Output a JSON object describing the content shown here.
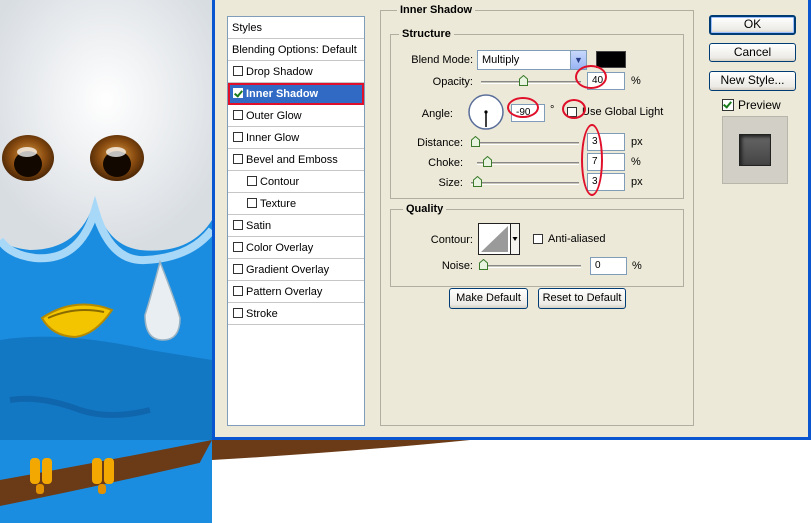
{
  "styles_panel": {
    "header": "Styles",
    "items": [
      {
        "label": "Blending Options: Default",
        "type": "header"
      },
      {
        "label": "Drop Shadow",
        "checked": false
      },
      {
        "label": "Inner Shadow",
        "checked": true,
        "selected": true
      },
      {
        "label": "Outer Glow",
        "checked": false
      },
      {
        "label": "Inner Glow",
        "checked": false
      },
      {
        "label": "Bevel and Emboss",
        "checked": false
      },
      {
        "label": "Contour",
        "checked": false,
        "sub": true
      },
      {
        "label": "Texture",
        "checked": false,
        "sub": true
      },
      {
        "label": "Satin",
        "checked": false
      },
      {
        "label": "Color Overlay",
        "checked": false
      },
      {
        "label": "Gradient Overlay",
        "checked": false
      },
      {
        "label": "Pattern Overlay",
        "checked": false
      },
      {
        "label": "Stroke",
        "checked": false
      }
    ]
  },
  "inner_shadow": {
    "title": "Inner Shadow",
    "structure": {
      "title": "Structure",
      "blend_mode_label": "Blend Mode:",
      "blend_mode_value": "Multiply",
      "shadow_color": "#000000",
      "opacity_label": "Opacity:",
      "opacity_value": "40",
      "opacity_unit": "%",
      "angle_label": "Angle:",
      "angle_value": "-90",
      "angle_unit": "°",
      "global_light_label": "Use Global Light",
      "distance_label": "Distance:",
      "distance_value": "3",
      "distance_unit": "px",
      "choke_label": "Choke:",
      "choke_value": "7",
      "choke_unit": "%",
      "size_label": "Size:",
      "size_value": "3",
      "size_unit": "px"
    },
    "quality": {
      "title": "Quality",
      "contour_label": "Contour:",
      "anti_aliased_label": "Anti-aliased",
      "noise_label": "Noise:",
      "noise_value": "0",
      "noise_unit": "%"
    },
    "make_default_label": "Make Default",
    "reset_default_label": "Reset to Default"
  },
  "actions": {
    "ok_label": "OK",
    "cancel_label": "Cancel",
    "new_style_label": "New Style...",
    "preview_label": "Preview"
  },
  "colors": {
    "selection": "#316ac5",
    "annotation_red": "#e0102a",
    "dialog_bg": "#ece9d8",
    "bird_blue": "#1e8fe0"
  }
}
